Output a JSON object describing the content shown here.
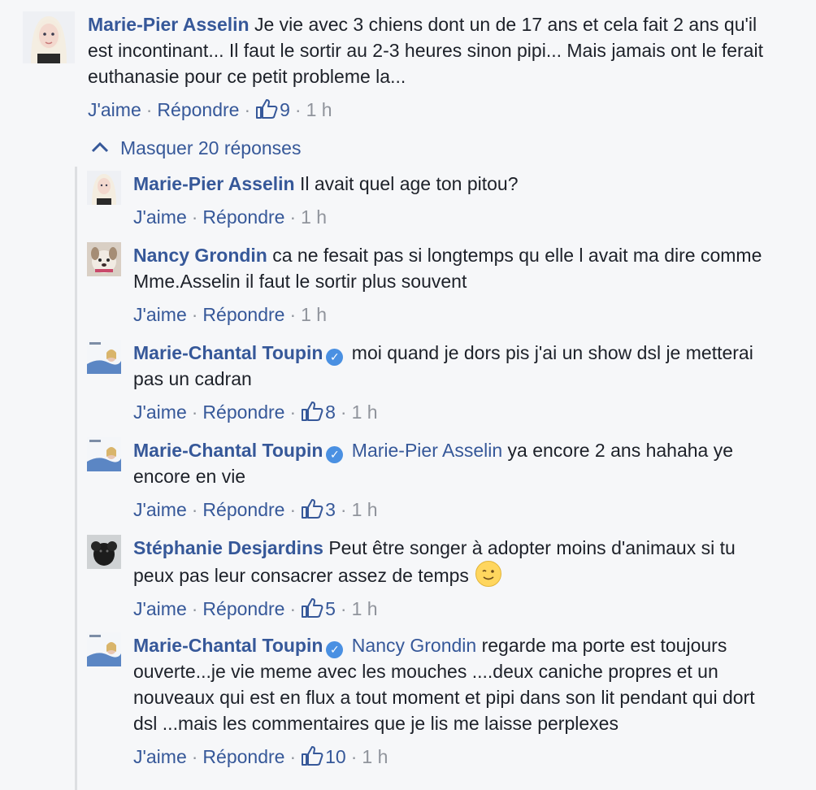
{
  "main_comment": {
    "author": "Marie-Pier Asselin",
    "text": "Je vie avec 3 chiens dont un de 17 ans et cela fait 2 ans qu'il est incontinant... Il faut le sortir au 2-3 heures sinon pipi... Mais jamais ont le ferait euthanasie pour ce petit probleme la...",
    "like_label": "J'aime",
    "reply_label": "Répondre",
    "likes": "9",
    "time": "1 h",
    "separator": "·"
  },
  "hide_replies_label": "Masquer 20 réponses",
  "replies": [
    {
      "author": "Marie-Pier Asselin",
      "verified": false,
      "mention": "",
      "text": "Il avait quel age ton pitou?",
      "like_label": "J'aime",
      "reply_label": "Répondre",
      "likes": "",
      "time": "1 h"
    },
    {
      "author": "Nancy Grondin",
      "verified": false,
      "mention": "",
      "text": "ca ne fesait pas si longtemps qu elle l avait ma dire comme Mme.Asselin il faut le sortir plus souvent",
      "like_label": "J'aime",
      "reply_label": "Répondre",
      "likes": "",
      "time": "1 h"
    },
    {
      "author": "Marie-Chantal Toupin",
      "verified": true,
      "mention": "",
      "text": "moi quand je dors pis j'ai un show dsl je metterai pas un cadran",
      "like_label": "J'aime",
      "reply_label": "Répondre",
      "likes": "8",
      "time": "1 h"
    },
    {
      "author": "Marie-Chantal Toupin",
      "verified": true,
      "mention": "Marie-Pier Asselin",
      "text": "ya encore 2 ans hahaha ye encore en vie",
      "like_label": "J'aime",
      "reply_label": "Répondre",
      "likes": "3",
      "time": "1 h"
    },
    {
      "author": "Stéphanie Desjardins",
      "verified": false,
      "mention": "",
      "text": "Peut être songer à adopter moins d'animaux si tu peux pas leur consacrer assez de temps",
      "emoji": "wink-emoji",
      "like_label": "J'aime",
      "reply_label": "Répondre",
      "likes": "5",
      "time": "1 h"
    },
    {
      "author": "Marie-Chantal Toupin",
      "verified": true,
      "mention": "Nancy Grondin",
      "text": "regarde ma porte est toujours ouverte...je vie meme avec les mouches ....deux caniche propres et un nouveaux qui est en flux a tout moment et pipi dans son lit pendant qui dort dsl ...mais les commentaires que je lis me laisse perplexes",
      "like_label": "J'aime",
      "reply_label": "Répondre",
      "likes": "10",
      "time": "1 h"
    }
  ],
  "colors": {
    "link": "#365899",
    "meta": "#90949c",
    "text": "#1d2129",
    "background": "#f6f7f9",
    "verified": "#4a90e2"
  },
  "icons": {
    "like": "thumbs-up-icon",
    "collapse": "chevron-up-icon",
    "verified": "verified-badge-icon"
  }
}
